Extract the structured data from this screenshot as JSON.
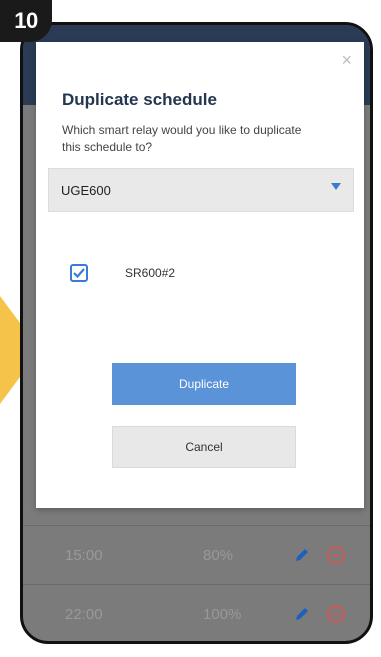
{
  "step": {
    "number": "10"
  },
  "dialog": {
    "close_glyph": "×",
    "title": "Duplicate schedule",
    "subtitle": "Which smart relay would you like to duplicate this schedule to?",
    "select": {
      "value": "UGE600"
    },
    "devices": [
      {
        "label": "SR600#2",
        "checked": true
      }
    ],
    "duplicate_label": "Duplicate",
    "cancel_label": "Cancel"
  },
  "schedule": {
    "rows": [
      {
        "time": "15:00",
        "value": "80%"
      },
      {
        "time": "22:00",
        "value": "100%"
      }
    ]
  },
  "colors": {
    "accent": "#5a93d8",
    "title": "#24364f",
    "badge": "#1a1a1a",
    "arrow": "#f6c34a",
    "remove": "#d9534f"
  }
}
